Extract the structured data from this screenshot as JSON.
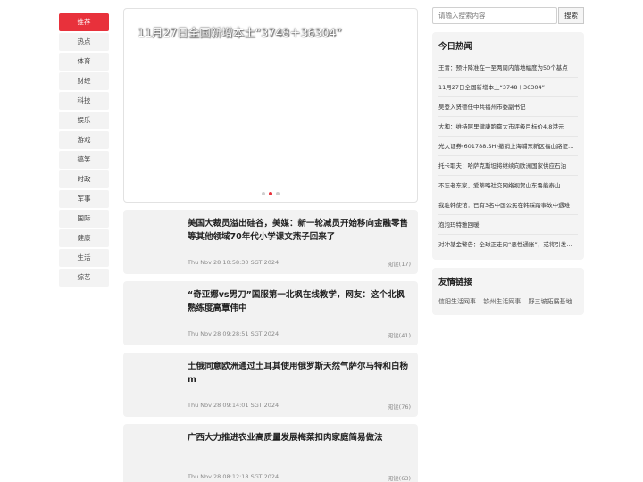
{
  "nav": {
    "items": [
      {
        "label": "推荐",
        "active": true
      },
      {
        "label": "热点"
      },
      {
        "label": "体育"
      },
      {
        "label": "财经"
      },
      {
        "label": "科技"
      },
      {
        "label": "娱乐"
      },
      {
        "label": "游戏"
      },
      {
        "label": "搞笑"
      },
      {
        "label": "时政"
      },
      {
        "label": "军事"
      },
      {
        "label": "国际"
      },
      {
        "label": "健康"
      },
      {
        "label": "生活"
      },
      {
        "label": "综艺"
      }
    ]
  },
  "banner": {
    "title": "11月27日全国新增本土“3748＋36304”",
    "slides": 3,
    "active_slide": 2
  },
  "news": [
    {
      "title": "美国大裁员溢出硅谷，美媒：新一轮减员开始移向金融零售等其他领域70年代小学课文燕子回来了",
      "time": "Thu Nov 28 10:58:30 SGT 2024",
      "reads": "阅读(17)"
    },
    {
      "title": "“奇亚娜vs男刀”国服第一北枫在线教学，网友：这个北枫熟练度高覃伟中",
      "time": "Thu Nov 28 09:28:51 SGT 2024",
      "reads": "阅读(41)"
    },
    {
      "title": "土俄同意欧洲通过土耳其使用俄罗斯天然气萨尔马特和白杨m",
      "time": "Thu Nov 28 09:14:01 SGT 2024",
      "reads": "阅读(76)"
    },
    {
      "title": "广西大力推进农业高质量发展梅菜扣肉家庭简易做法",
      "time": "Thu Nov 28 08:12:18 SGT 2024",
      "reads": "阅读(63)"
    }
  ],
  "search": {
    "placeholder": "请输入搜索内容",
    "button_label": "搜索"
  },
  "hot": {
    "title": "今日热闻",
    "items": [
      "王青：预计降准在一至两周内落地幅度为50个基点",
      "11月27日全国新增本土“3748＋36304”",
      "吴登入贤德任中共福州市委副书记",
      "大和：维持阿里健康跑赢大市评级目标价4.8港元",
      "光大证券(601788.SH)撤销上海浦东新区福山路证券营业部",
      "托卡耶夫：哈萨克斯坦将继续向欧洲国家供应石油",
      "不忘老东家，爱蒂略社交网络视贺山东鲁能泰山",
      "我驻韩使馆：已有3名中国公民在韩踩踏事故中遇难",
      "泡泡玛特雅回暖",
      "对冲基金警告：全球正走向“恶性通胀”，或将引发危机"
    ]
  },
  "friends": {
    "title": "友情链接",
    "links": [
      "信阳生活网事",
      "钦州生活网事",
      "野三坡拓展基地"
    ]
  }
}
